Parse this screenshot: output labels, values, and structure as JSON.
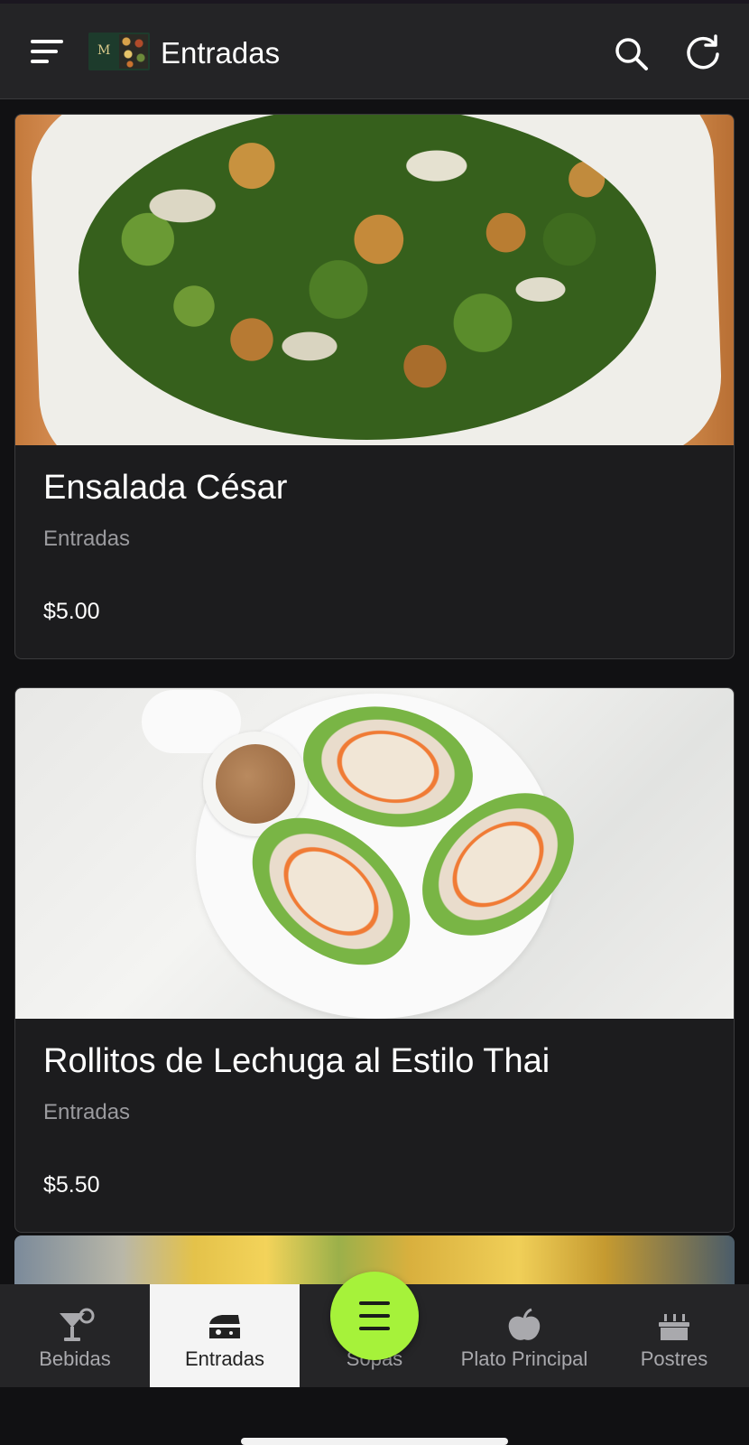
{
  "appbar": {
    "title": "Entradas",
    "logo_letter": "M"
  },
  "items": [
    {
      "name": "Ensalada César",
      "category": "Entradas",
      "price": "$5.00",
      "image": "caesar-salad"
    },
    {
      "name": "Rollitos de Lechuga al Estilo Thai",
      "category": "Entradas",
      "price": "$5.50",
      "image": "thai-lettuce-wraps"
    }
  ],
  "tabs": [
    {
      "label": "Bebidas",
      "icon": "cocktail-icon",
      "active": false
    },
    {
      "label": "Entradas",
      "icon": "cheese-icon",
      "active": true
    },
    {
      "label": "Sopas",
      "icon": "soup-icon",
      "active": false
    },
    {
      "label": "Plato Principal",
      "icon": "apple-icon",
      "active": false
    },
    {
      "label": "Postres",
      "icon": "cake-icon",
      "active": false
    }
  ],
  "colors": {
    "accent": "#a6f23a",
    "background": "#111113",
    "card": "#1c1c1e",
    "appbar": "#242426"
  }
}
